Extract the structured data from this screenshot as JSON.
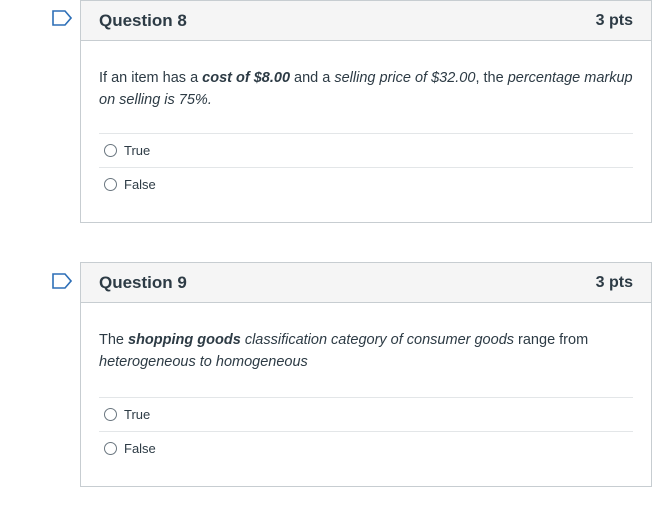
{
  "questions": [
    {
      "title": "Question 8",
      "points": "3 pts",
      "text_parts": {
        "p1": "If an item has a ",
        "p2": "cost of $8.00",
        "p3": " and a ",
        "p4": "selling price of $32.00",
        "p5": ", the ",
        "p6": "percentage markup on selling is 75%."
      },
      "answers": [
        "True",
        "False"
      ]
    },
    {
      "title": "Question 9",
      "points": "3 pts",
      "text_parts": {
        "p1": "The ",
        "p2": "shopping goods",
        "p3": " ",
        "p4": "classification category of consumer goods",
        "p5": " range from ",
        "p6": "heterogeneous to homogeneous"
      },
      "answers": [
        "True",
        "False"
      ]
    }
  ],
  "icons": {
    "flag": "flag-question-icon",
    "radio": "radio-button-icon"
  },
  "colors": {
    "header_bg": "#f5f5f5",
    "border": "#c7cdd1",
    "text": "#2d3b45"
  }
}
